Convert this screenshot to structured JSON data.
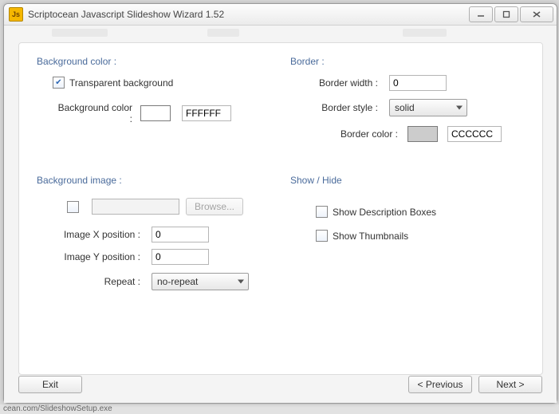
{
  "window": {
    "title": "Scriptocean Javascript Slideshow Wizard 1.52",
    "app_icon_text": "Js"
  },
  "sections": {
    "bg_color_title": "Background color :",
    "bg_image_title": "Background image :",
    "border_title": "Border :",
    "showhide_title": "Show / Hide"
  },
  "bg_color": {
    "transparent_label": "Transparent background",
    "transparent_checked": true,
    "color_label": "Background color :",
    "color_value": "FFFFFF",
    "swatch_hex": "#FFFFFF"
  },
  "bg_image": {
    "enabled_checked": false,
    "path_value": "",
    "browse_label": "Browse...",
    "x_label": "Image X position :",
    "x_value": "0",
    "y_label": "Image Y position :",
    "y_value": "0",
    "repeat_label": "Repeat :",
    "repeat_value": "no-repeat"
  },
  "border": {
    "width_label": "Border width :",
    "width_value": "0",
    "style_label": "Border style :",
    "style_value": "solid",
    "color_label": "Border color :",
    "color_value": "CCCCCC",
    "swatch_hex": "#CCCCCC"
  },
  "showhide": {
    "desc_checked": false,
    "desc_label": "Show Description Boxes",
    "thumb_checked": false,
    "thumb_label": "Show Thumbnails"
  },
  "footer": {
    "exit_label": "Exit",
    "prev_label": "< Previous",
    "next_label": "Next >"
  },
  "behind_text": "cean.com/SlideshowSetup.exe"
}
